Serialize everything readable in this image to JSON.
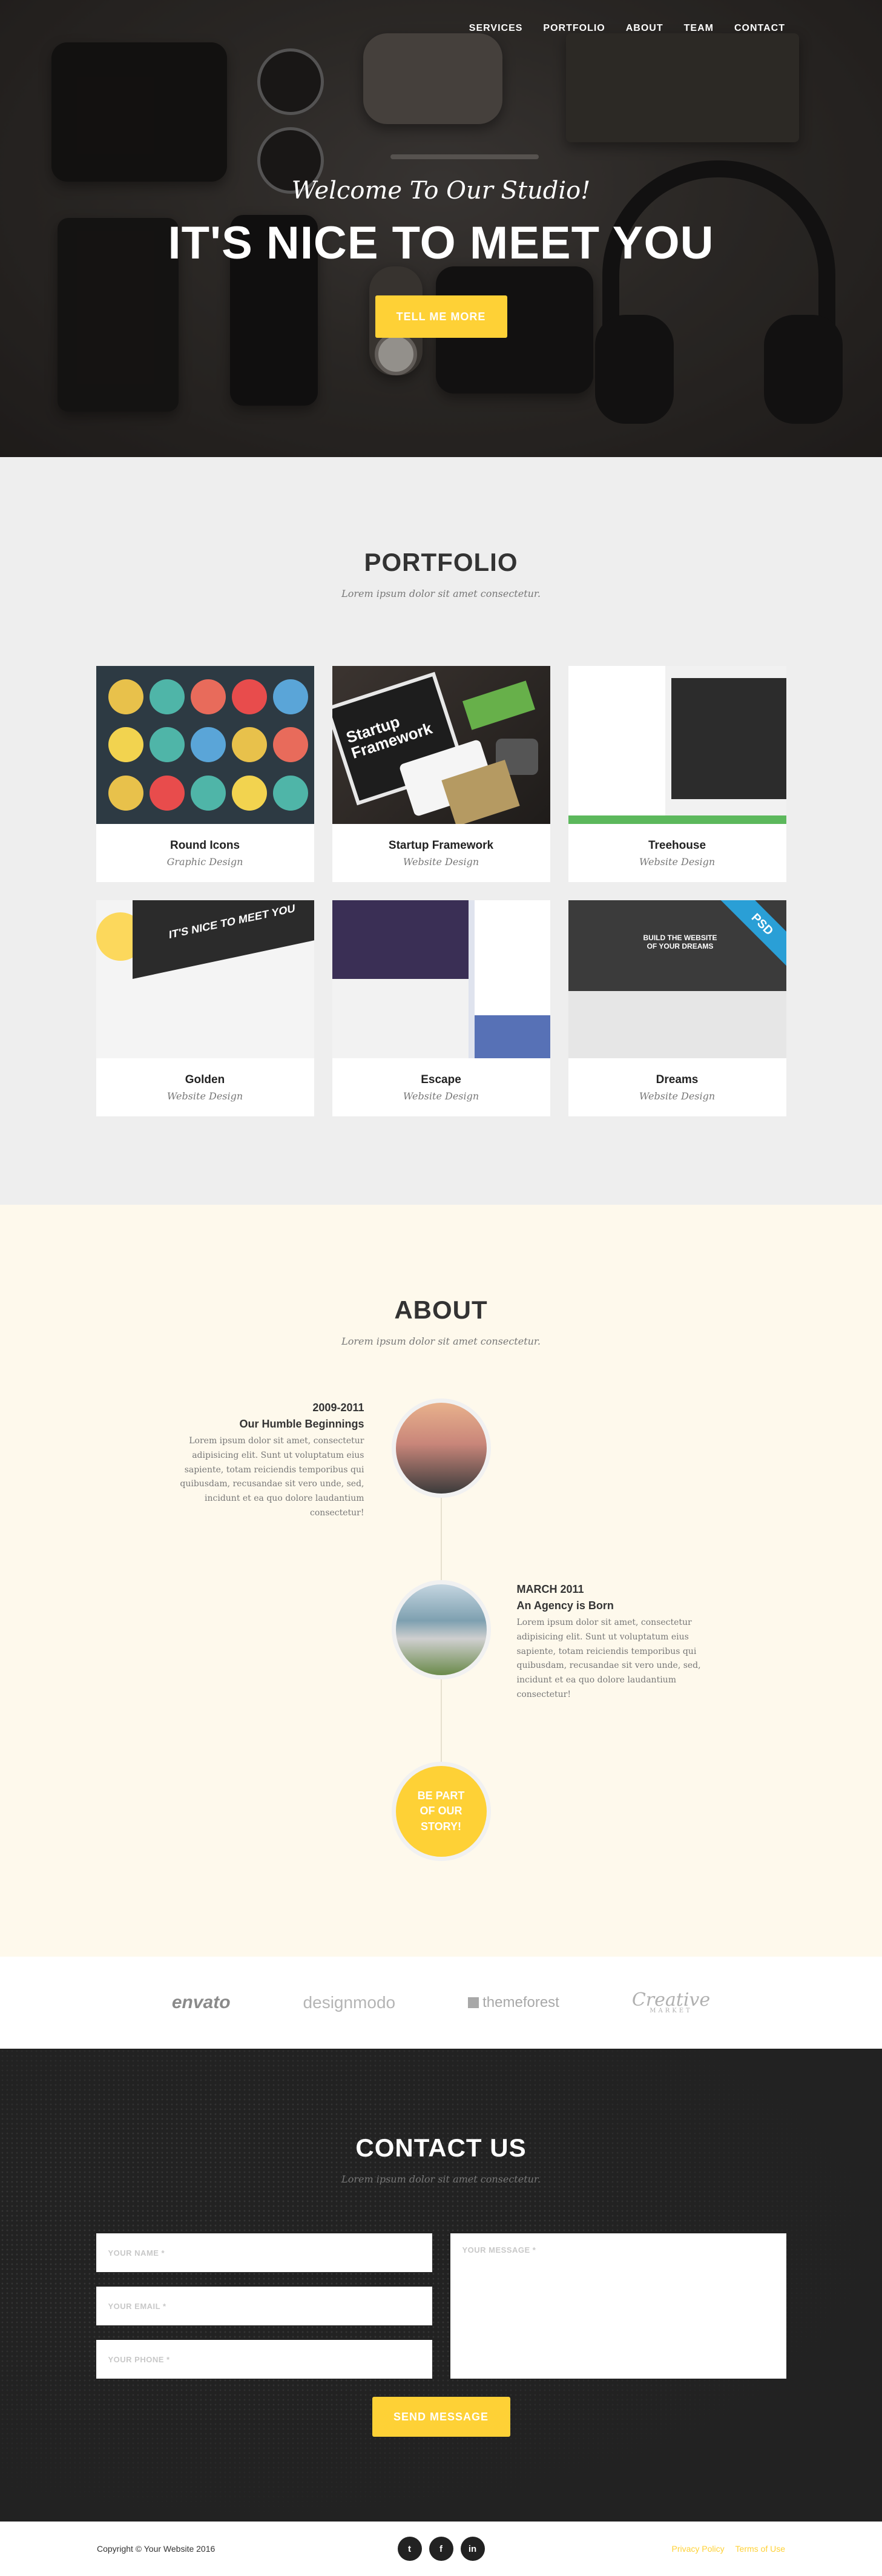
{
  "colors": {
    "accent": "#fed136",
    "dark": "#222222",
    "portfolio_bg": "#eeeeee",
    "about_bg": "#fef9ec"
  },
  "nav": {
    "services": "SERVICES",
    "portfolio": "PORTFOLIO",
    "about": "ABOUT",
    "team": "TEAM",
    "contact": "CONTACT"
  },
  "hero": {
    "subheading": "Welcome To Our Studio!",
    "heading": "IT'S NICE TO MEET YOU",
    "button": "TELL ME MORE"
  },
  "portfolio": {
    "title": "PORTFOLIO",
    "subtitle": "Lorem ipsum dolor sit amet consectetur.",
    "items": [
      {
        "title": "Round Icons",
        "category": "Graphic Design"
      },
      {
        "title": "Startup Framework",
        "category": "Website Design",
        "thumb_text": "Startup Framework"
      },
      {
        "title": "Treehouse",
        "category": "Website Design"
      },
      {
        "title": "Golden",
        "category": "Website Design",
        "thumb_text": "IT'S NICE TO MEET YOU"
      },
      {
        "title": "Escape",
        "category": "Website Design"
      },
      {
        "title": "Dreams",
        "category": "Website Design",
        "thumb_text": "BUILD THE WEBSITE OF YOUR DREAMS",
        "badge": "PSD"
      }
    ],
    "icon_colors": [
      "#e8c14b",
      "#4fb5a8",
      "#e86b5b",
      "#e84c4c",
      "#5aa5d8",
      "#f2d34f",
      "#4fb5a8",
      "#5aa5d8",
      "#e8c14b",
      "#e86b5b",
      "#e8c14b",
      "#e84c4c",
      "#4fb5a8",
      "#f2d34f",
      "#4fb5a8"
    ]
  },
  "about": {
    "title": "ABOUT",
    "subtitle": "Lorem ipsum dolor sit amet consectetur.",
    "timeline": [
      {
        "date": "2009-2011",
        "heading": "Our Humble Beginnings",
        "body": "Lorem ipsum dolor sit amet, consectetur adipisicing elit. Sunt ut voluptatum eius sapiente, totam reiciendis temporibus qui quibusdam, recusandae sit vero unde, sed, incidunt et ea quo dolore laudantium consectetur!"
      },
      {
        "date": "MARCH 2011",
        "heading": "An Agency is Born",
        "body": "Lorem ipsum dolor sit amet, consectetur adipisicing elit. Sunt ut voluptatum eius sapiente, totam reiciendis temporibus qui quibusdam, recusandae sit vero unde, sed, incidunt et ea quo dolore laudantium consectetur!"
      }
    ],
    "cta_line1": "BE PART",
    "cta_line2": "OF OUR",
    "cta_line3": "STORY!"
  },
  "clients": {
    "envato": "envato",
    "designmodo": "designmodo",
    "themeforest": "themeforest",
    "creative": "Creative",
    "creative_small": "MARKET"
  },
  "contact": {
    "title": "CONTACT US",
    "subtitle": "Lorem ipsum dolor sit amet consectetur.",
    "name_placeholder": "YOUR NAME *",
    "email_placeholder": "YOUR EMAIL *",
    "phone_placeholder": "YOUR PHONE *",
    "message_placeholder": "YOUR MESSAGE *",
    "button": "SEND MESSAGE"
  },
  "footer": {
    "copyright": "Copyright © Your Website 2016",
    "social": {
      "twitter": "t",
      "facebook": "f",
      "linkedin": "in"
    },
    "privacy": "Privacy Policy",
    "terms": "Terms of Use"
  }
}
